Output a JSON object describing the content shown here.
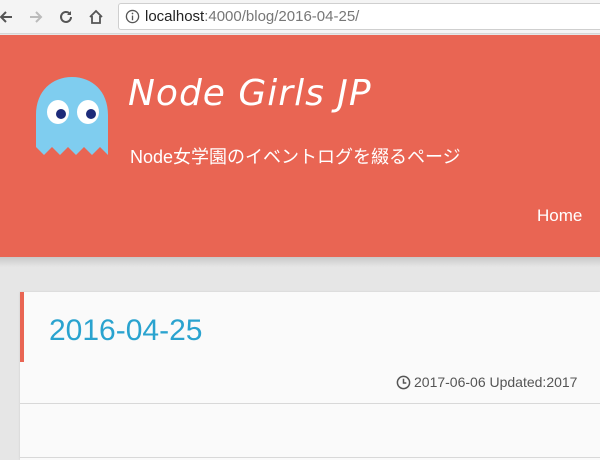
{
  "browser": {
    "url_host": "localhost",
    "url_rest": ":4000/blog/2016-04-25/"
  },
  "site": {
    "title": "Node Girls JP",
    "subtitle": "Node女学園のイベントログを綴るページ",
    "nav": {
      "home_label": "Home"
    }
  },
  "post": {
    "title": "2016-04-25",
    "meta": "2017-06-06 Updated:2017"
  },
  "colors": {
    "header_bg": "#e96553",
    "title_link": "#2aa3cf",
    "ghost_body": "#7fcdef"
  }
}
